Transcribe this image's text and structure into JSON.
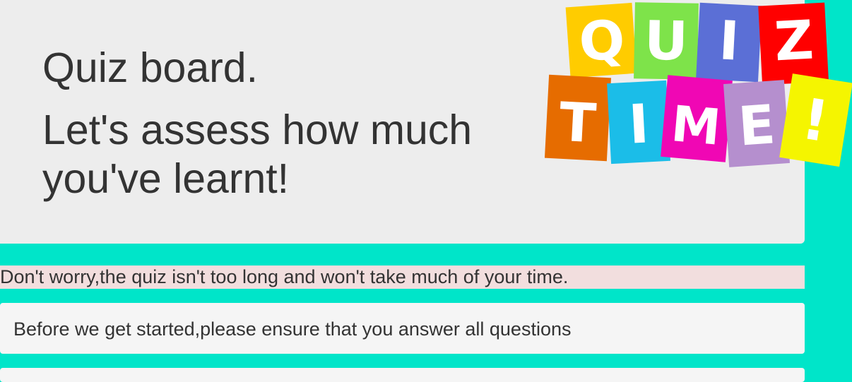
{
  "header": {
    "title": "Quiz board.",
    "subtitle": "Let's assess how much you've learnt!"
  },
  "logo": {
    "name": "quiz-time-logo",
    "letters": [
      "Q",
      "U",
      "I",
      "Z",
      "T",
      "I",
      "M",
      "E",
      "!"
    ],
    "colors": [
      "#ffcc00",
      "#7ee34a",
      "#5b6fd6",
      "#ff0000",
      "#e66c00",
      "#1bbde8",
      "#f007b4",
      "#b58fce",
      "#f5f500"
    ]
  },
  "notice": {
    "text": "Don't worry,the quiz isn't too long and won't take much of your time."
  },
  "instructions": {
    "text": "Before we get started,please ensure that you answer all questions"
  },
  "colors": {
    "background": "#00e5c9",
    "jumbotron": "#ededed",
    "notice_bg": "#f2dede",
    "panel_bg": "#f5f5f5",
    "text": "#333333"
  }
}
